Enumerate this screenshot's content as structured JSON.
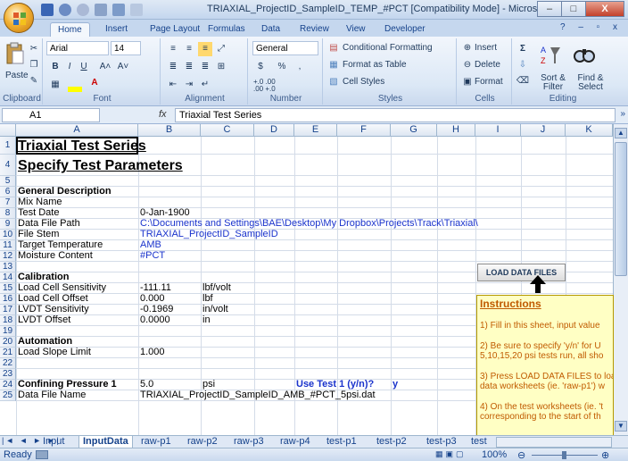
{
  "window": {
    "title": "TRIAXIAL_ProjectID_SampleID_TEMP_#PCT  [Compatibility Mode] - Microsoft Ex...",
    "minimize": "–",
    "maximize": "□",
    "close": "X"
  },
  "ribbon_tabs": [
    "Home",
    "Insert",
    "Page Layout",
    "Formulas",
    "Data",
    "Review",
    "View",
    "Developer"
  ],
  "ribbon": {
    "clipboard": {
      "paste": "Paste",
      "label": "Clipboard"
    },
    "font": {
      "name": "Arial",
      "size": "14",
      "label": "Font",
      "bold": "B",
      "italic": "I",
      "underline": "U",
      "grow": "A˄",
      "shrink": "A˅"
    },
    "alignment": {
      "label": "Alignment"
    },
    "number": {
      "format": "General",
      "currency": "$",
      "percent": "%",
      "comma": ",",
      "inc": "+.0 .00",
      "dec": ".00 +.0",
      "label": "Number"
    },
    "styles": {
      "conditional": "Conditional Formatting",
      "table": "Format as Table",
      "cell": "Cell Styles",
      "label": "Styles"
    },
    "cells": {
      "insert": "Insert",
      "delete": "Delete",
      "format": "Format",
      "label": "Cells"
    },
    "editing": {
      "sigma": "Σ",
      "sort": "Sort & Filter",
      "find": "Find & Select",
      "label": "Editing"
    }
  },
  "formula_bar": {
    "cell_ref": "A1",
    "fx": "fx",
    "value": "Triaxial Test Series"
  },
  "columns": [
    "A",
    "B",
    "C",
    "D",
    "E",
    "F",
    "G",
    "H",
    "I",
    "J",
    "K"
  ],
  "rows": [
    {
      "num": "1",
      "a": "Triaxial Test Series",
      "style": "big"
    },
    {
      "num": "4",
      "a": "Specify Test Parameters",
      "style": "big"
    },
    {
      "num": "5"
    },
    {
      "num": "6",
      "a": "General Description",
      "style": "bold"
    },
    {
      "num": "7",
      "a": "Mix Name"
    },
    {
      "num": "8",
      "a": "Test Date",
      "b": "0-Jan-1900"
    },
    {
      "num": "9",
      "a": "Data File Path",
      "b": "C:\\Documents and Settings\\BAE\\Desktop\\My Dropbox\\Projects\\Track\\Triaxial\\",
      "b_color": "blue"
    },
    {
      "num": "10",
      "a": "File Stem",
      "b": "TRIAXIAL_ProjectID_SampleID",
      "b_color": "blue"
    },
    {
      "num": "11",
      "a": "Target Temperature",
      "b": "AMB",
      "b_color": "blue"
    },
    {
      "num": "12",
      "a": "Moisture Content",
      "b": "#PCT",
      "b_color": "blue"
    },
    {
      "num": "13"
    },
    {
      "num": "14",
      "a": "Calibration",
      "style": "bold"
    },
    {
      "num": "15",
      "a": "Load Cell Sensitivity",
      "b": "-111.11",
      "c": "lbf/volt"
    },
    {
      "num": "16",
      "a": "Load Cell Offset",
      "b": "0.000",
      "c": "lbf"
    },
    {
      "num": "17",
      "a": "LVDT Sensitivity",
      "b": "-0.1969",
      "c": "in/volt"
    },
    {
      "num": "18",
      "a": "LVDT Offset",
      "b": "0.0000",
      "c": "in"
    },
    {
      "num": "19"
    },
    {
      "num": "20",
      "a": "Automation",
      "style": "bold"
    },
    {
      "num": "21",
      "a": "Load Slope Limit",
      "b": "1.000"
    },
    {
      "num": "22"
    },
    {
      "num": "23"
    },
    {
      "num": "24",
      "a": "Confining Pressure 1",
      "b": "5.0",
      "c": "psi",
      "e": "Use Test 1 (y/n)?",
      "g": "y",
      "style": "bold"
    },
    {
      "num": "25",
      "a": "Data File Name",
      "b": "TRIAXIAL_ProjectID_SampleID_AMB_#PCT_5psi.dat"
    }
  ],
  "load_button": "LOAD DATA FILES",
  "instructions": {
    "title": "Instructions",
    "lines": [
      "1) Fill in this sheet, input value",
      "2) Be sure to specify 'y/n' for U",
      "5,10,15,20 psi tests run, all sho",
      "3) Press LOAD DATA FILES to loa",
      "data worksheets (ie. 'raw-p1') w",
      "4) On the test worksheets (ie. 't",
      "corresponding to the start of th"
    ]
  },
  "sheet_tabs": [
    "Input",
    "InputData",
    "raw-p1",
    "raw-p2",
    "raw-p3",
    "raw-p4",
    "test-p1",
    "test-p2",
    "test-p3",
    "test"
  ],
  "active_sheet": "InputData",
  "status": {
    "ready": "Ready",
    "zoom": "100%"
  }
}
